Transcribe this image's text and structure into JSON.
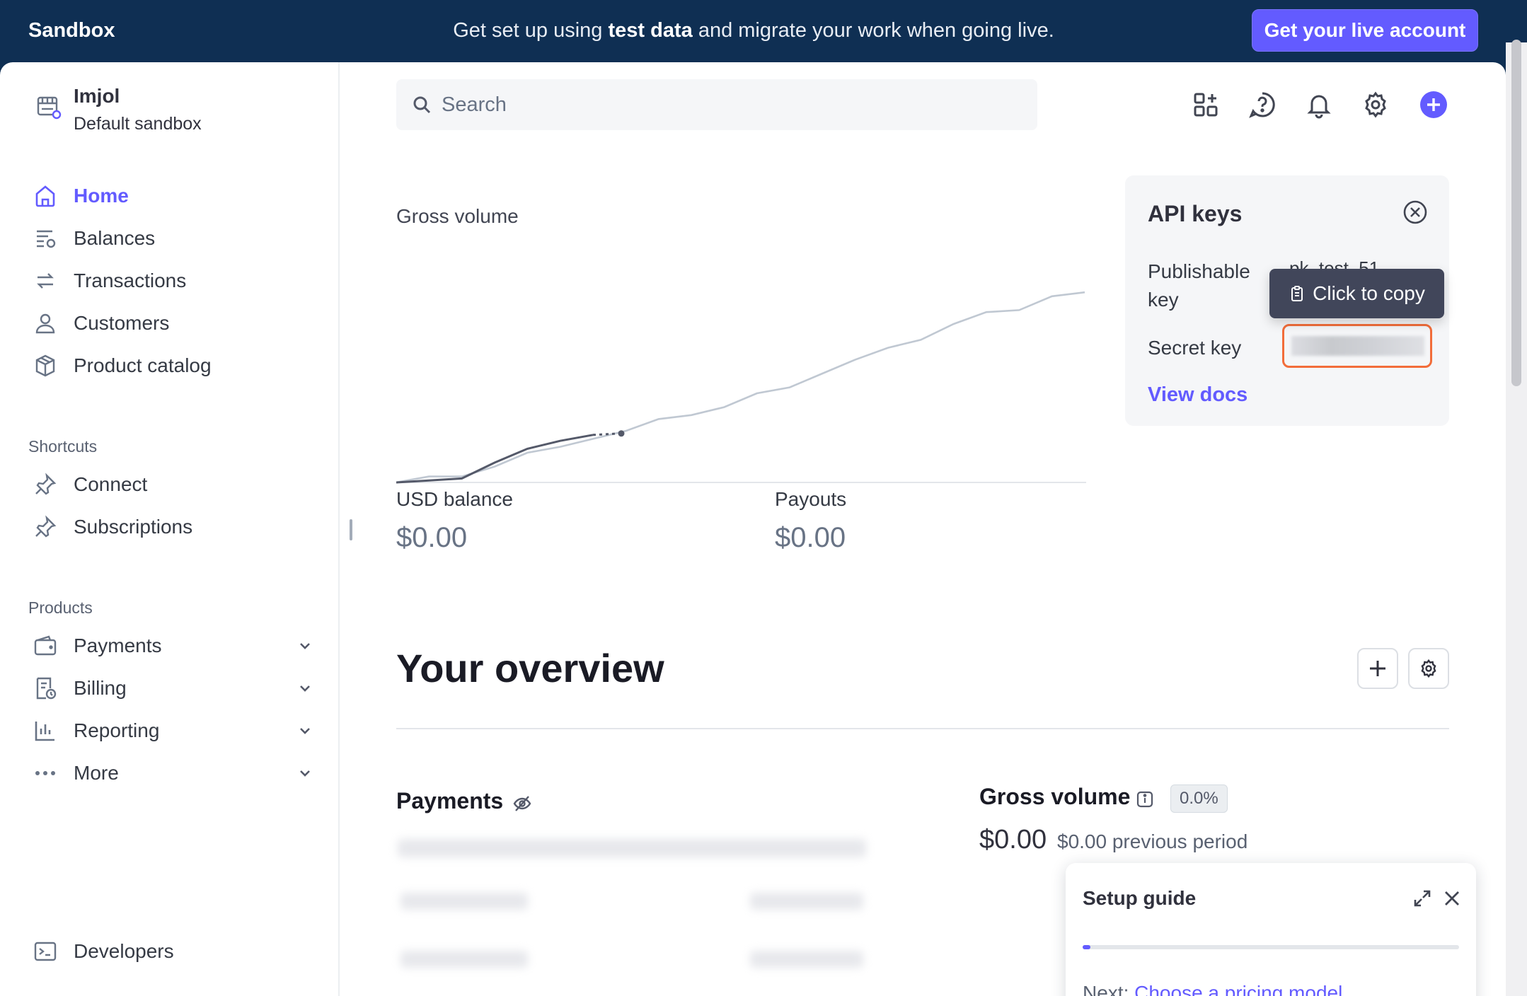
{
  "banner": {
    "brand": "Sandbox",
    "message_prefix": "Get set up using ",
    "message_bold": "test data",
    "message_suffix": " and migrate your work when going live.",
    "cta": "Get your live account"
  },
  "account": {
    "name": "Imjol",
    "sandbox": "Default sandbox"
  },
  "nav": {
    "main": [
      {
        "label": "Home",
        "icon": "home-icon",
        "active": true
      },
      {
        "label": "Balances",
        "icon": "balances-icon"
      },
      {
        "label": "Transactions",
        "icon": "transactions-icon"
      },
      {
        "label": "Customers",
        "icon": "customer-icon"
      },
      {
        "label": "Product catalog",
        "icon": "box-icon"
      }
    ],
    "shortcuts_label": "Shortcuts",
    "shortcuts": [
      {
        "label": "Connect",
        "icon": "pin-icon"
      },
      {
        "label": "Subscriptions",
        "icon": "pin-icon"
      }
    ],
    "products_label": "Products",
    "products": [
      {
        "label": "Payments",
        "icon": "wallet-icon"
      },
      {
        "label": "Billing",
        "icon": "billing-icon"
      },
      {
        "label": "Reporting",
        "icon": "bar-chart-icon"
      },
      {
        "label": "More",
        "icon": "more-icon"
      }
    ],
    "developers": {
      "label": "Developers",
      "icon": "terminal-icon"
    }
  },
  "search": {
    "placeholder": "Search"
  },
  "header_icons": [
    "apps-icon",
    "help-icon",
    "bell-icon",
    "gear-icon",
    "plus-circle-icon"
  ],
  "gross_volume_chart": {
    "title": "Gross volume",
    "chart_data": {
      "type": "line",
      "series": [
        {
          "values": [
            0,
            0.03,
            0.03,
            0.08,
            0.15,
            0.18,
            0.22,
            0.26,
            0.32,
            0.34,
            0.38,
            0.45,
            0.48,
            0.55,
            0.62,
            0.68,
            0.72,
            0.8,
            0.86,
            0.87,
            0.94,
            0.96
          ],
          "color": "#c0c8d2"
        },
        {
          "values": [
            0,
            0.01,
            0.02,
            0.1,
            0.17,
            0.21,
            0.24
          ],
          "color": "#545969"
        }
      ],
      "ylim": [
        0,
        1
      ]
    },
    "accent_color": "#545969",
    "base_color": "#c0c8d2"
  },
  "api_keys": {
    "title": "API keys",
    "publishable_label": "Publishable key",
    "publishable_value": "pk_test_51...",
    "secret_label": "Secret key",
    "view_docs": "View docs",
    "tooltip": "Click to copy"
  },
  "stats": {
    "usd_label": "USD balance",
    "usd_value": "$0.00",
    "payouts_label": "Payouts",
    "payouts_value": "$0.00"
  },
  "overview": {
    "title": "Your overview",
    "payments_title": "Payments",
    "gross_volume_title": "Gross volume",
    "gross_volume_badge": "0.0%",
    "gross_volume_value": "$0.00",
    "gross_volume_prev": "$0.00 previous period"
  },
  "setup_guide": {
    "title": "Setup guide",
    "next_prefix": "Next: ",
    "next_link": "Choose a pricing model",
    "progress": 0.02
  },
  "colors": {
    "accent": "#635bff",
    "banner": "#0f2f53",
    "highlight": "#f26d3a"
  }
}
